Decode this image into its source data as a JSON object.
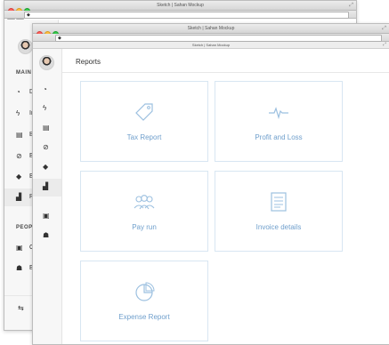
{
  "window_title": "Sketch | Sahan Mockup",
  "back_window": {
    "sidebar": {
      "section_main": "MAIN M",
      "items": [
        {
          "icon": "dashboard-icon",
          "label": "D"
        },
        {
          "icon": "lightning-icon",
          "label": "In"
        },
        {
          "icon": "briefcase-icon",
          "label": "B"
        },
        {
          "icon": "compass-icon",
          "label": "E"
        },
        {
          "icon": "tag-icon",
          "label": "E"
        },
        {
          "icon": "bar-chart-icon",
          "label": "R"
        }
      ],
      "section_people": "PEOPLE",
      "people_items": [
        {
          "icon": "card-icon",
          "label": "C"
        },
        {
          "icon": "users-icon",
          "label": "E"
        }
      ],
      "bottom_icon": "swap-arrows-icon"
    }
  },
  "front_window": {
    "page_title": "Reports",
    "sidebar_icons": [
      "dashboard-icon",
      "lightning-icon",
      "briefcase-icon",
      "compass-icon",
      "tag-icon",
      "bar-chart-icon",
      "card-icon",
      "users-icon"
    ],
    "active_item": "bar-chart-icon",
    "cards": [
      {
        "label": "Tax Report",
        "icon": "tag-icon"
      },
      {
        "label": "Profit and Loss",
        "icon": "pulse-icon"
      },
      {
        "label": "Pay run",
        "icon": "people-group-icon"
      },
      {
        "label": "Invoice details",
        "icon": "document-icon"
      },
      {
        "label": "Expense Report",
        "icon": "pie-chart-icon"
      }
    ]
  },
  "colors": {
    "card_border": "#d8e6f2",
    "card_text": "#6f9fcc",
    "sidebar_bg": "#f7f7f7"
  }
}
